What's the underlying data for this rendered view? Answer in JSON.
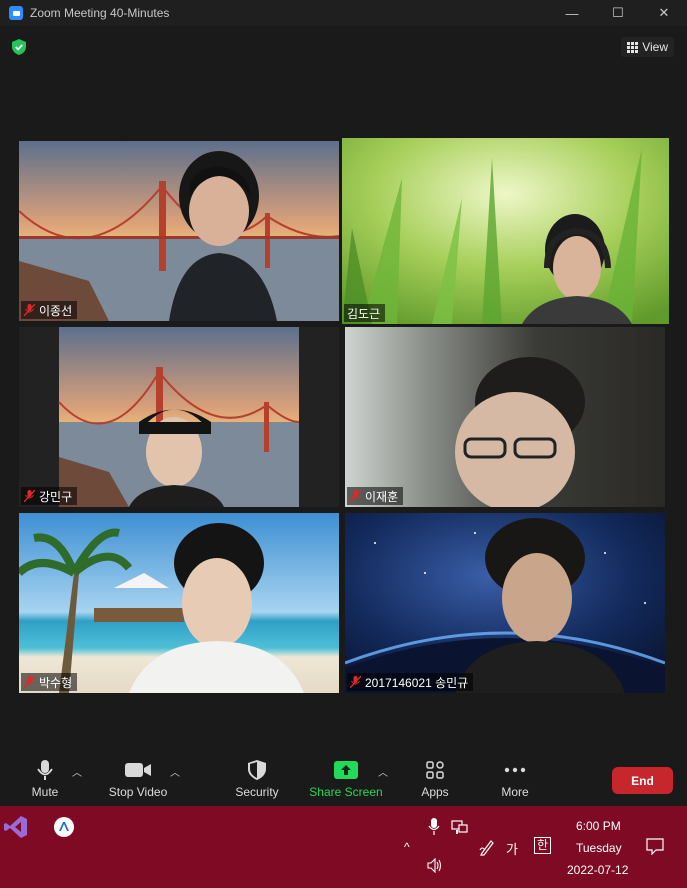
{
  "window": {
    "title": "Zoom Meeting 40-Minutes",
    "controls": [
      "—",
      "☐",
      "✕"
    ]
  },
  "view_button": {
    "label": "View"
  },
  "participants": [
    {
      "name": "이종선",
      "muted": true,
      "active": false
    },
    {
      "name": "김도근",
      "muted": false,
      "active": true
    },
    {
      "name": "강민구",
      "muted": true,
      "active": false
    },
    {
      "name": "이재훈",
      "muted": true,
      "active": false
    },
    {
      "name": "박수형",
      "muted": true,
      "active": false
    },
    {
      "name": "2017146021 송민규",
      "muted": true,
      "active": false
    }
  ],
  "toolbar": {
    "mute_label": "Mute",
    "video_label": "Stop Video",
    "security_label": "Security",
    "share_label": "Share Screen",
    "apps_label": "Apps",
    "more_label": "More",
    "end_label": "End"
  },
  "taskbar": {
    "time": "6:00 PM",
    "day": "Tuesday",
    "date": "2022-07-12",
    "ime_mode": "가",
    "ime_lang": "한",
    "chevron": "^"
  },
  "colors": {
    "accent_green": "#23d959",
    "end_red": "#c7272c",
    "active_border": "#c8f06e",
    "taskbar": "#7f0a23"
  }
}
